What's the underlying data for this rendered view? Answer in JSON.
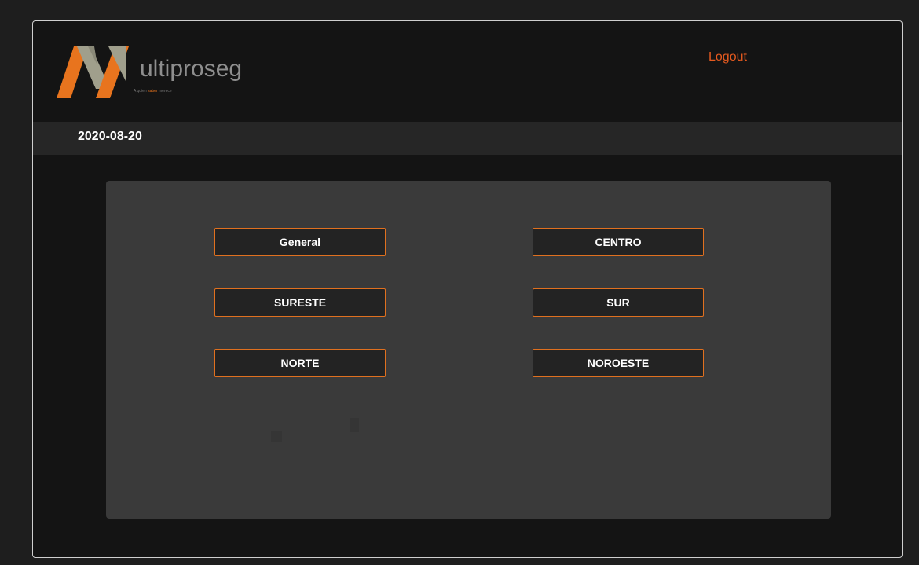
{
  "header": {
    "logo": {
      "letter": "M",
      "word": "ultiproseg",
      "tagline_pre": "A quien ",
      "tagline_highlight": "saber",
      "tagline_post": " merece",
      "colors": {
        "orange": "#e8741e",
        "gray": "#a09f8c"
      }
    },
    "logout_label": "Logout"
  },
  "date_bar": {
    "date": "2020-08-20"
  },
  "regions": {
    "general": "General",
    "centro": "CENTRO",
    "sureste": "SURESTE",
    "sur": "SUR",
    "norte": "NORTE",
    "noroeste": "NOROESTE"
  },
  "colors": {
    "accent": "#e0701f",
    "logout": "#e55a1f",
    "page_bg": "#141414",
    "panel_bg": "#3a3a3a",
    "button_bg": "#232323"
  }
}
